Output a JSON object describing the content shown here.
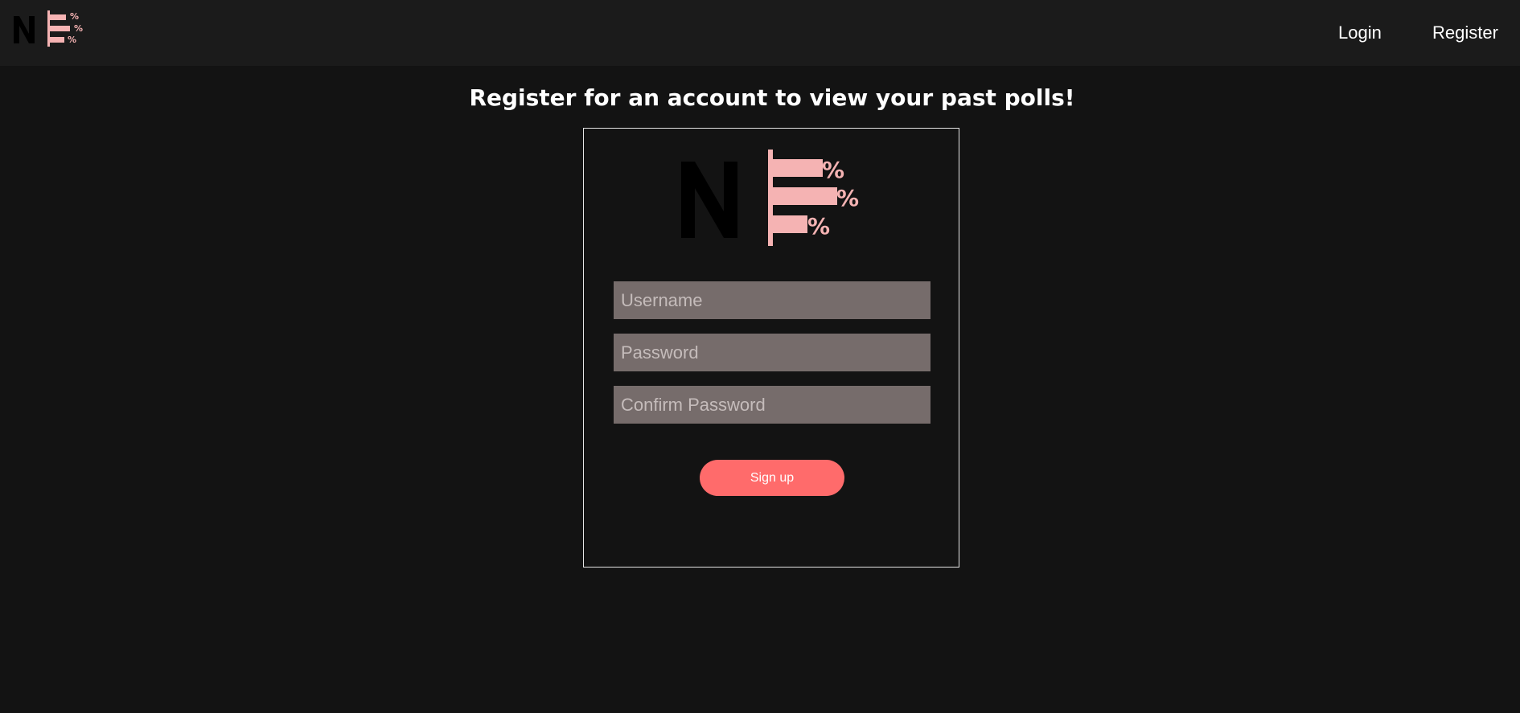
{
  "navbar": {
    "logo": "ne-percent-logo",
    "login_label": "Login",
    "register_label": "Register"
  },
  "page": {
    "title": "Register for an account to view your past polls!"
  },
  "form": {
    "username_placeholder": "Username",
    "password_placeholder": "Password",
    "confirm_placeholder": "Confirm Password",
    "signup_label": "Sign up"
  },
  "colors": {
    "background": "#131313",
    "navbar": "#1b1b1b",
    "field": "#766c6b",
    "accent": "#ff6b6b",
    "logo_pink": "#f5b3b3"
  }
}
